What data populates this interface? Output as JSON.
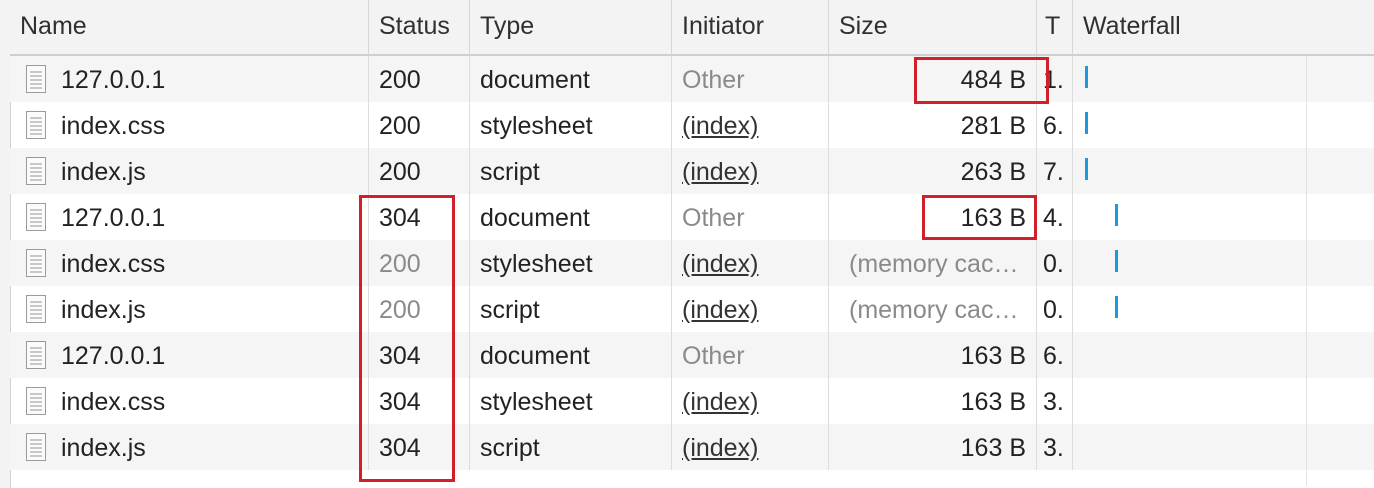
{
  "columns": {
    "name": "Name",
    "status": "Status",
    "type": "Type",
    "initiator": "Initiator",
    "size": "Size",
    "time": "T",
    "waterfall": "Waterfall"
  },
  "rows": [
    {
      "name": "127.0.0.1",
      "status": "200",
      "type": "document",
      "initiator": "Other",
      "size": "484 B",
      "time": "1.",
      "status_muted": false,
      "initiator_link": false
    },
    {
      "name": "index.css",
      "status": "200",
      "type": "stylesheet",
      "initiator": "(index)",
      "size": "281 B",
      "time": "6.",
      "status_muted": false,
      "initiator_link": true
    },
    {
      "name": "index.js",
      "status": "200",
      "type": "script",
      "initiator": "(index)",
      "size": "263 B",
      "time": "7.",
      "status_muted": false,
      "initiator_link": true
    },
    {
      "name": "127.0.0.1",
      "status": "304",
      "type": "document",
      "initiator": "Other",
      "size": "163 B",
      "time": "4.",
      "status_muted": false,
      "initiator_link": false
    },
    {
      "name": "index.css",
      "status": "200",
      "type": "stylesheet",
      "initiator": "(index)",
      "size": "(memory cac…",
      "time": "0.",
      "status_muted": true,
      "initiator_link": true
    },
    {
      "name": "index.js",
      "status": "200",
      "type": "script",
      "initiator": "(index)",
      "size": "(memory cac…",
      "time": "0.",
      "status_muted": true,
      "initiator_link": true
    },
    {
      "name": "127.0.0.1",
      "status": "304",
      "type": "document",
      "initiator": "Other",
      "size": "163 B",
      "time": "6.",
      "status_muted": false,
      "initiator_link": false
    },
    {
      "name": "index.css",
      "status": "304",
      "type": "stylesheet",
      "initiator": "(index)",
      "size": "163 B",
      "time": "3.",
      "status_muted": false,
      "initiator_link": true
    },
    {
      "name": "index.js",
      "status": "304",
      "type": "script",
      "initiator": "(index)",
      "size": "163 B",
      "time": "3.",
      "status_muted": false,
      "initiator_link": true
    }
  ],
  "icons": {
    "row_icon": "document-icon"
  },
  "colors": {
    "highlight": "#d0202a",
    "waterfall_bar": "#1a9be0",
    "muted_text": "#8a8a8a"
  }
}
